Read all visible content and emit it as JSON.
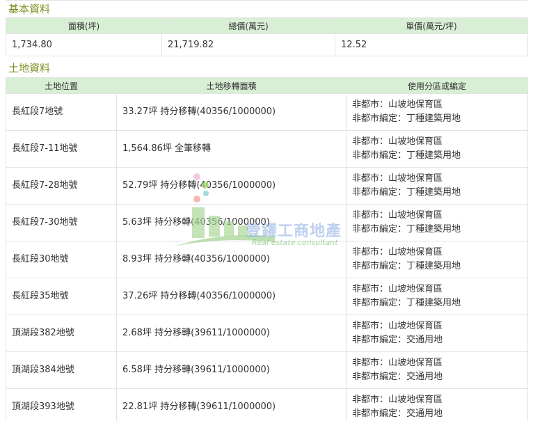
{
  "basic_info": {
    "title": "基本資料",
    "headers": [
      "面積(坪)",
      "總價(萬元)",
      "單價(萬元/坪)"
    ],
    "values": [
      "1,734.80",
      "21,719.82",
      "12.52"
    ]
  },
  "land_info": {
    "title": "土地資料",
    "headers": [
      "土地位置",
      "土地移轉面積",
      "使用分區或編定"
    ],
    "rows": [
      {
        "location": "長紅段7地號",
        "area": "33.27坪 持分移轉(40356/1000000)",
        "zone1": "非都市：山坡地保育區",
        "zone2": "非都市編定：丁種建築用地"
      },
      {
        "location": "長紅段7-11地號",
        "area": "1,564.86坪 全筆移轉",
        "zone1": "非都市：山坡地保育區",
        "zone2": "非都市編定：丁種建築用地"
      },
      {
        "location": "長紅段7-28地號",
        "area": "52.79坪 持分移轉(40356/1000000)",
        "zone1": "非都市：山坡地保育區",
        "zone2": "非都市編定：丁種建築用地"
      },
      {
        "location": "長紅段7-30地號",
        "area": "5.63坪 持分移轉(40356/1000000)",
        "zone1": "非都市：山坡地保育區",
        "zone2": "非都市編定：丁種建築用地"
      },
      {
        "location": "長紅段30地號",
        "area": "8.93坪 持分移轉(40356/1000000)",
        "zone1": "非都市：山坡地保育區",
        "zone2": "非都市編定：丁種建築用地"
      },
      {
        "location": "長紅段35地號",
        "area": "37.26坪 持分移轉(40356/1000000)",
        "zone1": "非都市：山坡地保育區",
        "zone2": "非都市編定：丁種建築用地"
      },
      {
        "location": "頂湖段382地號",
        "area": "2.68坪 持分移轉(39611/1000000)",
        "zone1": "非都市：山坡地保育區",
        "zone2": "非都市編定：交通用地"
      },
      {
        "location": "頂湖段384地號",
        "area": "6.58坪 持分移轉(39611/1000000)",
        "zone1": "非都市：山坡地保育區",
        "zone2": "非都市編定：交通用地"
      },
      {
        "location": "頂湖段393地號",
        "area": "22.81坪 持分移轉(39611/1000000)",
        "zone1": "非都市：山坡地保育區",
        "zone2": "非都市編定：交通用地"
      }
    ]
  },
  "watermark": {
    "name": "壹鑵工商地產",
    "subtitle": "Real estate consultant"
  },
  "colors": {
    "section_title": "#7a8f1f",
    "header_bg": "#d8efd5",
    "border": "#e3e3e3",
    "text": "#333333"
  }
}
